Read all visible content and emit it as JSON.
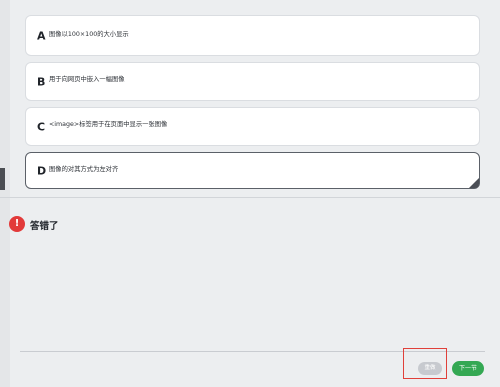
{
  "options": [
    {
      "letter": "A",
      "text": "图像以100×100的大小显示"
    },
    {
      "letter": "B",
      "text": "用于向网页中嵌入一幅图像"
    },
    {
      "letter": "C",
      "text": "<image>标签用于在页面中显示一张图像"
    },
    {
      "letter": "D",
      "text": "图像的对其方式为左对齐"
    }
  ],
  "result": {
    "icon": "!",
    "message": "答错了"
  },
  "footer": {
    "reset_label": "重做",
    "next_label": "下一节"
  },
  "colors": {
    "error": "#e23a3a",
    "next_button": "#34a853",
    "highlight": "#e0403a"
  }
}
